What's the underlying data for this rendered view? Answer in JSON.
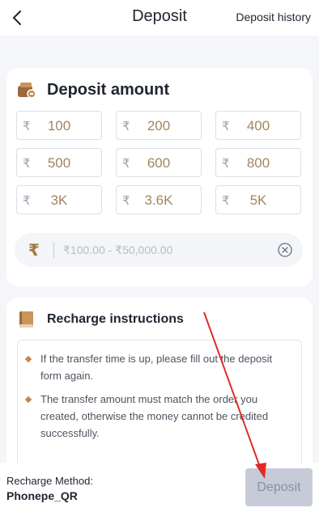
{
  "header": {
    "title": "Deposit",
    "history_label": "Deposit history"
  },
  "amount_section": {
    "title": "Deposit amount",
    "currency_symbol": "₹",
    "presets": [
      "100",
      "200",
      "400",
      "500",
      "600",
      "800",
      "3K",
      "3.6K",
      "5K"
    ],
    "input": {
      "symbol": "₹",
      "placeholder": "₹100.00 - ₹50,000.00",
      "value": ""
    }
  },
  "instructions": {
    "title": "Recharge instructions",
    "items": [
      "If the transfer time is up, please fill out the deposit form again.",
      "The transfer amount must match the order you created, otherwise the money cannot be credited successfully."
    ]
  },
  "footer": {
    "method_label": "Recharge Method:",
    "method_value": "Phonepe_QR",
    "deposit_label": "Deposit"
  },
  "colors": {
    "accent": "#a2855f",
    "arrow": "#e02a2a",
    "disabled_button": "#c7cbd8"
  }
}
